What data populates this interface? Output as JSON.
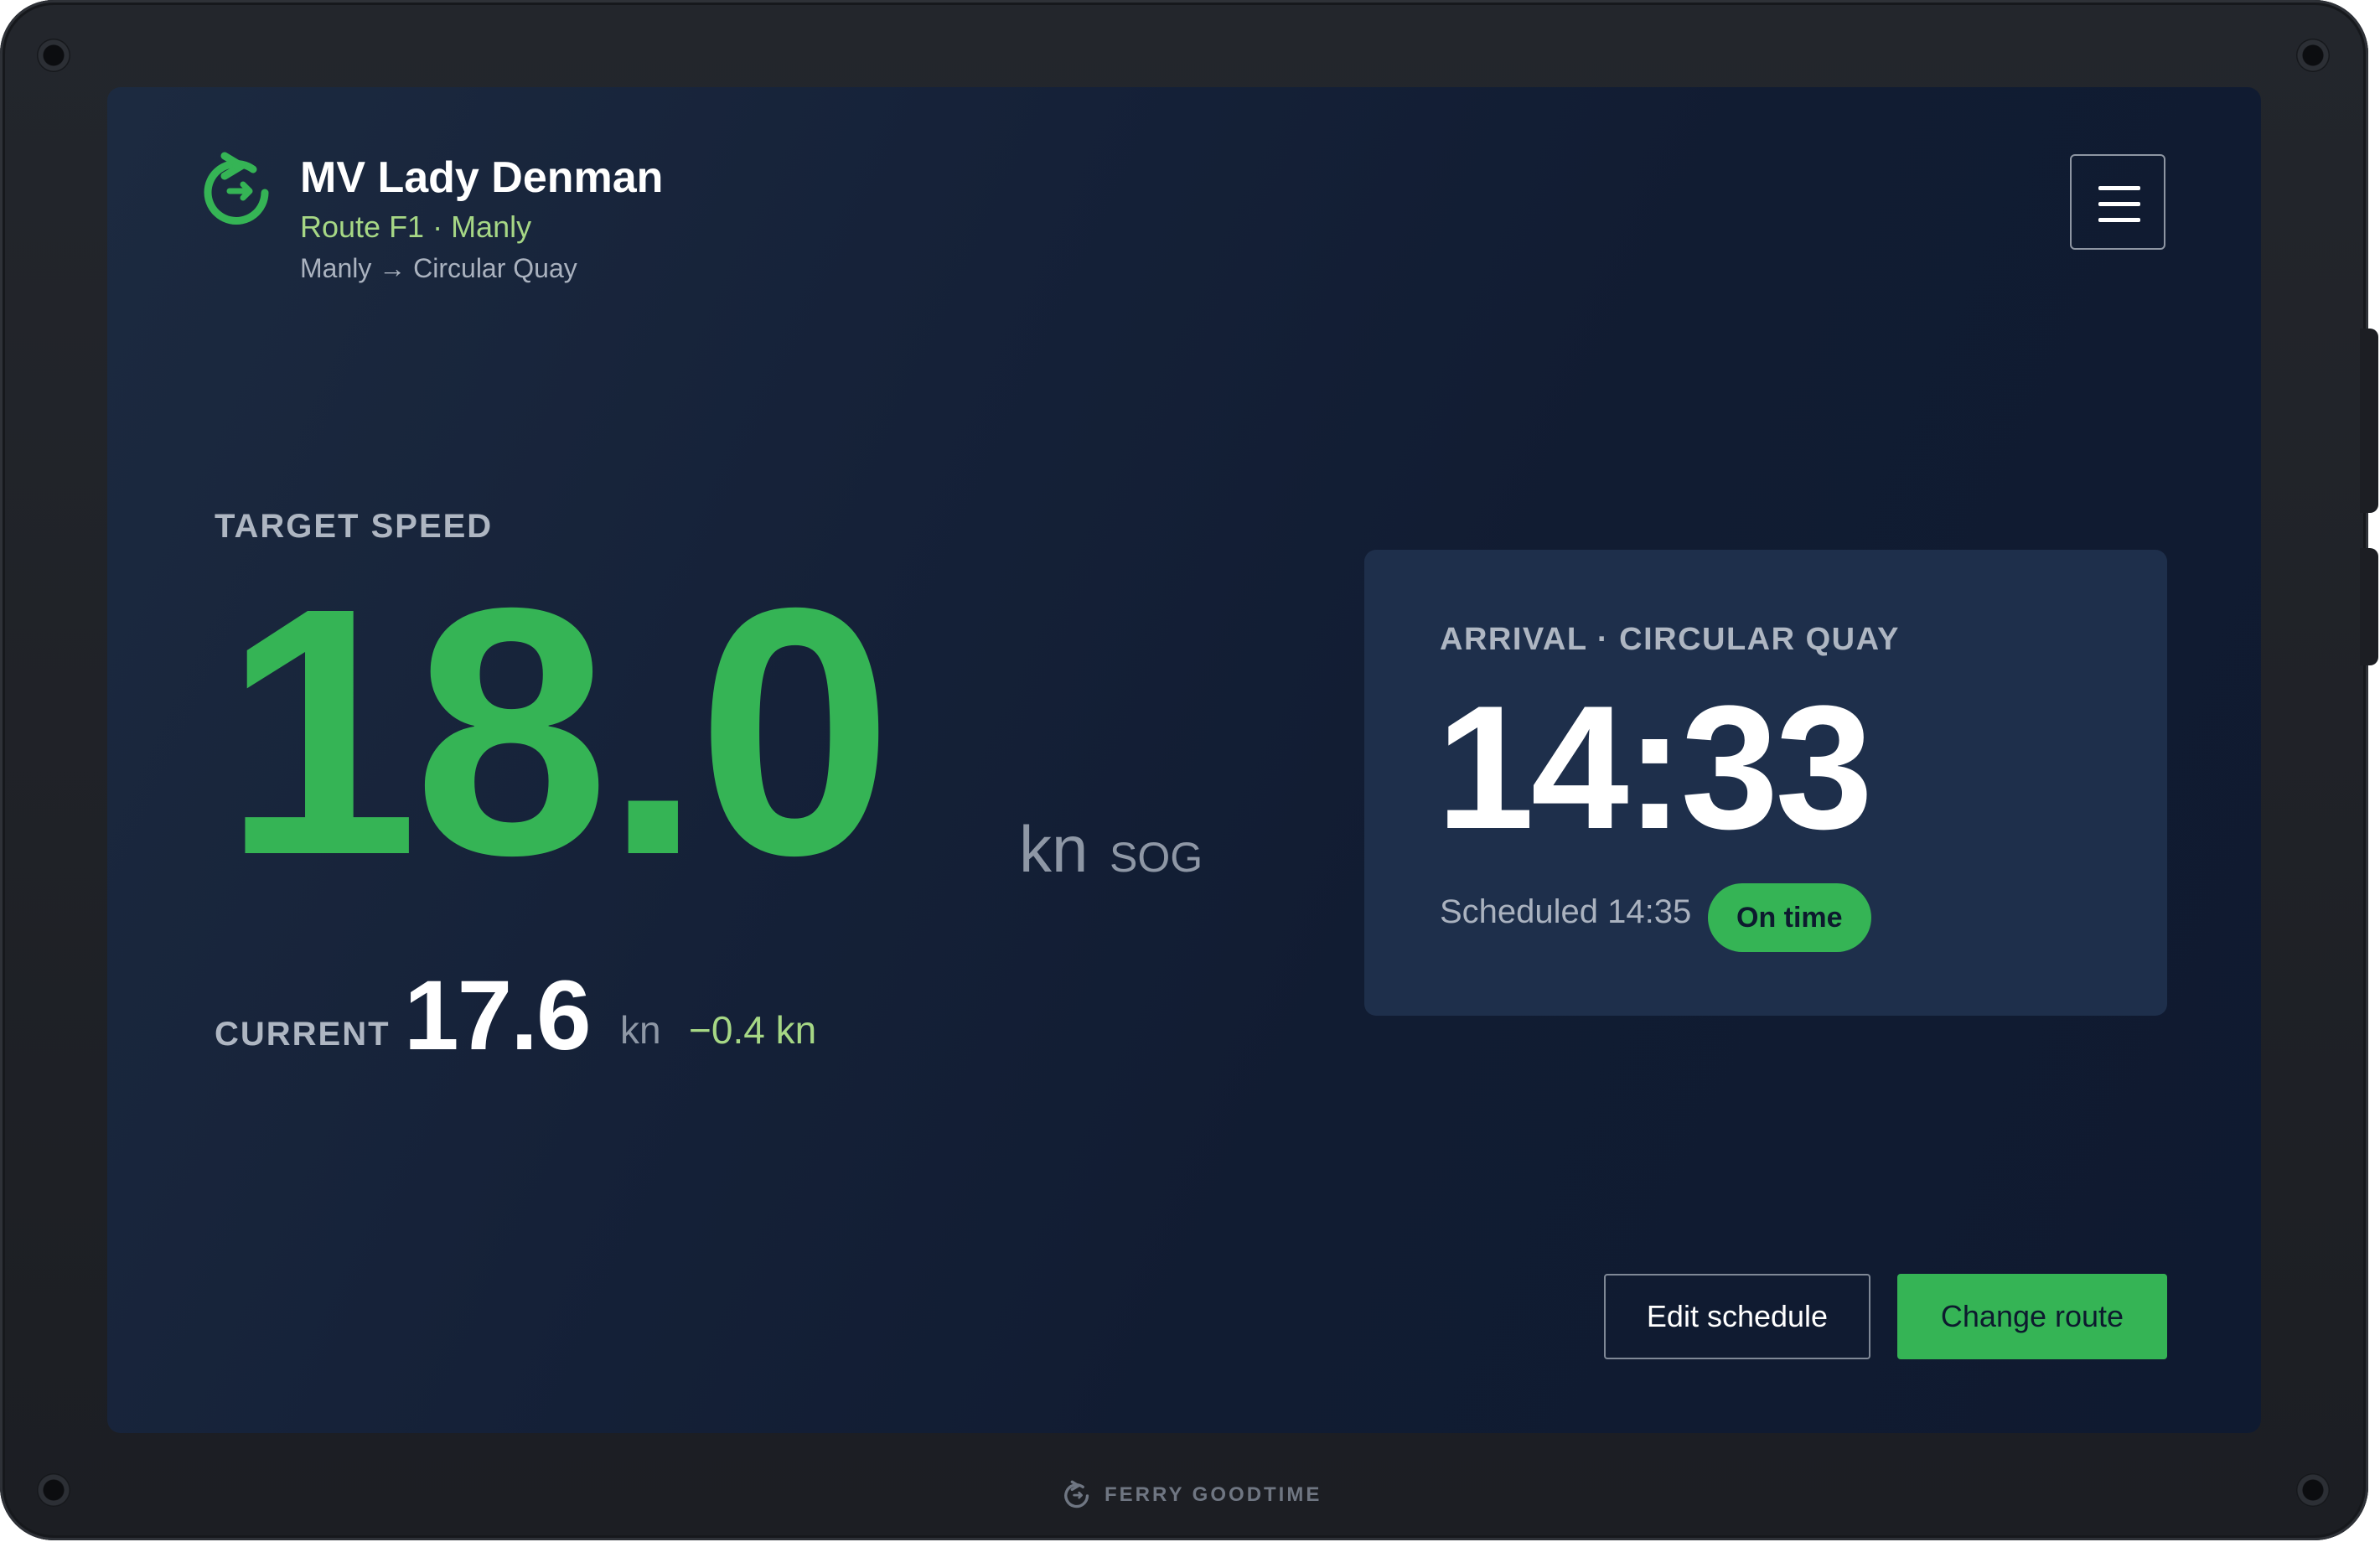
{
  "header": {
    "vessel_name": "MV Lady Denman",
    "route": "Route F1 · Manly",
    "direction": "Manly → Circular Quay"
  },
  "target_speed": {
    "label": "TARGET SPEED",
    "value": "18.0",
    "unit": "kn",
    "unit_suffix": "SOG"
  },
  "current_speed": {
    "label": "CURRENT",
    "value": "17.6",
    "unit": "kn",
    "delta": "−0.4 kn"
  },
  "arrival": {
    "label": "ARRIVAL · CIRCULAR QUAY",
    "time": "14:33",
    "scheduled": "Scheduled 14:35",
    "status": "On time"
  },
  "actions": {
    "edit_label": "Edit schedule",
    "change_label": "Change route"
  },
  "footer": {
    "brand": "FERRY GOODTIME"
  },
  "colors": {
    "accent": "#35b455",
    "route_text": "#a6d785",
    "screen_bg": "#152138",
    "card_bg": "#1e2f4b"
  },
  "icons": {
    "logo": "circular-arrow-icon",
    "menu": "hamburger-menu-icon"
  }
}
